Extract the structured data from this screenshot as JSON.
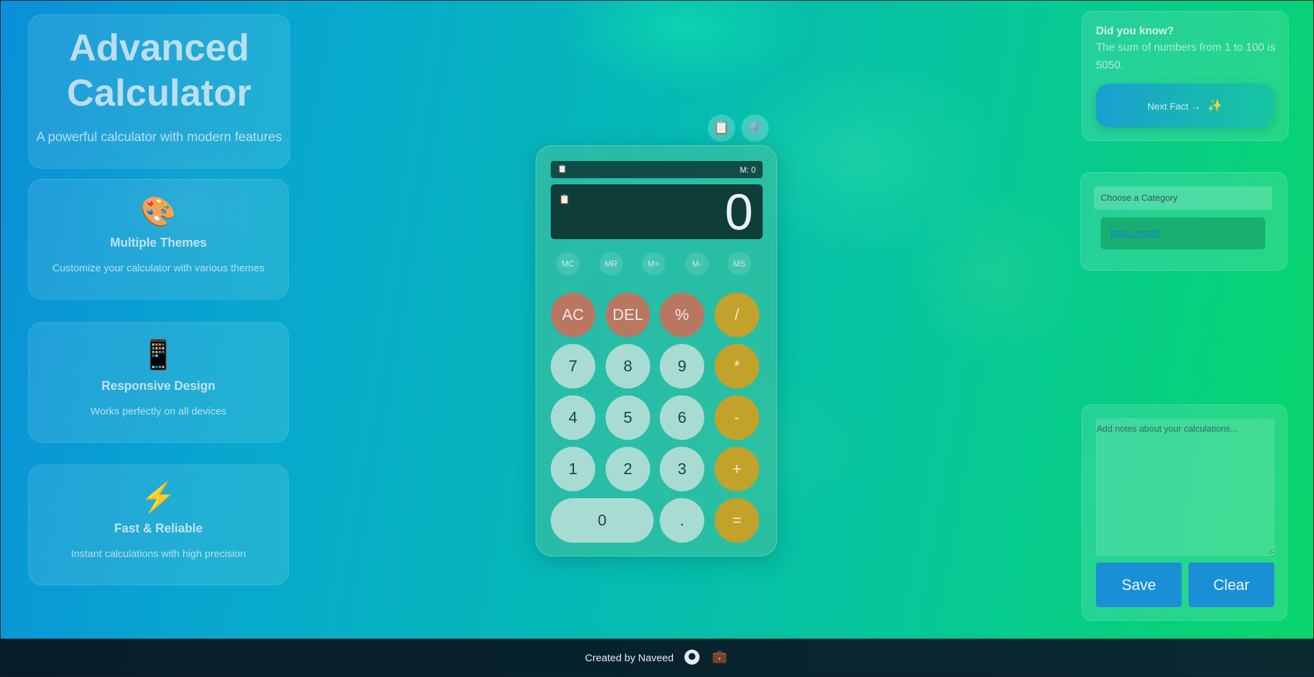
{
  "hero": {
    "title_line1": "Advanced",
    "title_line2": "Calculator",
    "subtitle": "A powerful calculator with modern features"
  },
  "features": [
    {
      "icon": "🎨",
      "icon_name": "palette-icon",
      "title": "Multiple Themes",
      "desc": "Customize your calculator with various themes"
    },
    {
      "icon": "📱",
      "icon_name": "mobile-phone-icon",
      "title": "Responsive Design",
      "desc": "Works perfectly on all devices"
    },
    {
      "icon": "⚡",
      "icon_name": "lightning-icon",
      "title": "Fast & Reliable",
      "desc": "Instant calculations with high precision"
    }
  ],
  "calculator": {
    "top_buttons": {
      "history_icon": "📋",
      "settings_icon": "⚙️"
    },
    "memory_line": {
      "icon": "📋",
      "memory": "M: 0"
    },
    "display": {
      "icon": "📋",
      "value": "0"
    },
    "memory_buttons": [
      "MC",
      "MR",
      "M+",
      "M-",
      "MS"
    ],
    "keys": {
      "ac": "AC",
      "del": "DEL",
      "percent": "%",
      "divide": "/",
      "seven": "7",
      "eight": "8",
      "nine": "9",
      "multiply": "*",
      "four": "4",
      "five": "5",
      "six": "6",
      "minus": "-",
      "one": "1",
      "two": "2",
      "three": "3",
      "plus": "+",
      "zero": "0",
      "dot": ".",
      "equals": "="
    }
  },
  "fact": {
    "heading": "Did you know?",
    "text": "The sum of numbers from 1 to 100 is 5050.",
    "button": "Next Fact →",
    "button_icon": "✨"
  },
  "category": {
    "label": "Choose a Category",
    "selected": "basic-math"
  },
  "notes": {
    "placeholder": "Add notes about your calculations...",
    "save": "Save",
    "clear": "Clear"
  },
  "footer": {
    "credit": "Created by Naveed",
    "github_icon": "github-icon",
    "briefcase_icon": "briefcase-icon"
  },
  "colors": {
    "function_key": "#b97761",
    "operator_key": "#c3a22b",
    "number_key": "#a8dcd2",
    "primary_button": "#1a8fd6"
  }
}
